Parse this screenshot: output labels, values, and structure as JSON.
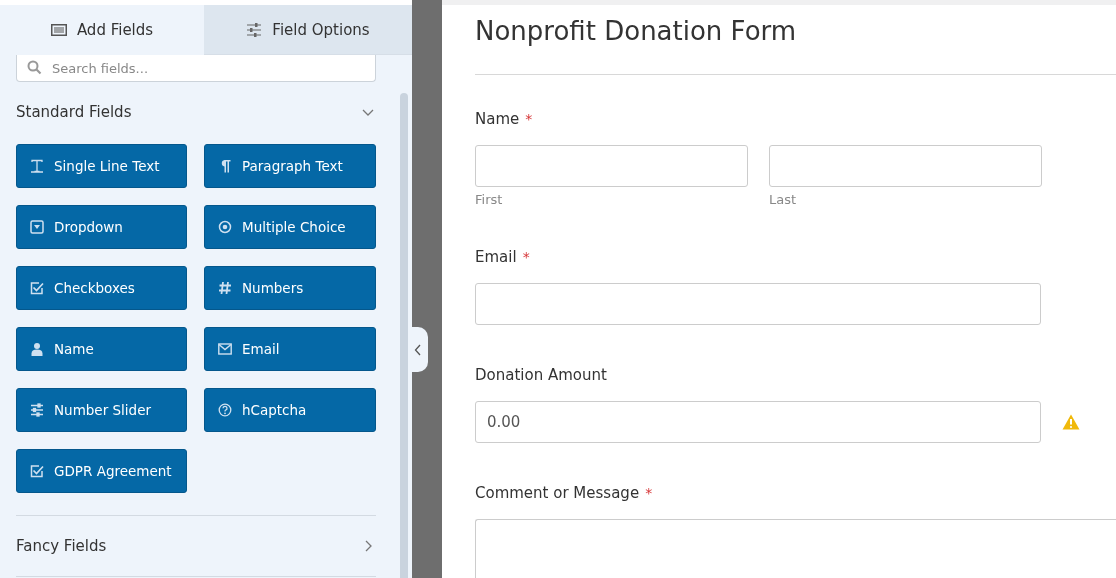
{
  "tabs": [
    {
      "label": "Add Fields",
      "selected": true
    },
    {
      "label": "Field Options",
      "selected": false
    }
  ],
  "search": {
    "placeholder": "Search fields..."
  },
  "sections": [
    {
      "title": "Standard Fields",
      "expanded": true,
      "buttons": [
        "Single Line Text",
        "Paragraph Text",
        "Dropdown",
        "Multiple Choice",
        "Checkboxes",
        "Numbers",
        "Name",
        "Email",
        "Number Slider",
        "hCaptcha",
        "GDPR Agreement"
      ]
    },
    {
      "title": "Fancy Fields",
      "expanded": false
    }
  ],
  "form": {
    "title": "Nonprofit Donation Form",
    "fields": [
      {
        "kind": "name",
        "label": "Name",
        "required_mark": "*",
        "sublabels": [
          "First",
          "Last"
        ]
      },
      {
        "kind": "text",
        "label": "Email",
        "required_mark": "*"
      },
      {
        "kind": "text",
        "label": "Donation Amount",
        "value": "0.00",
        "warning": true
      },
      {
        "kind": "textarea",
        "label": "Comment or Message",
        "required_mark": "*"
      }
    ]
  }
}
